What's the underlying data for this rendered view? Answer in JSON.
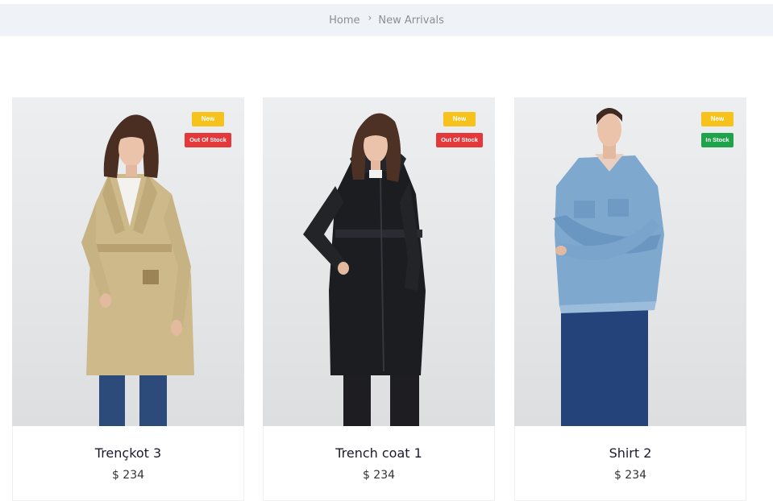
{
  "breadcrumb": {
    "home": "Home",
    "separator": ">",
    "current": "New Arrivals"
  },
  "products": [
    {
      "name": "Trençkot 3",
      "price": "$ 234",
      "badges": {
        "new": "New",
        "stock": "Out Of Stock"
      },
      "stock_status": "out"
    },
    {
      "name": "Trench coat 1",
      "price": "$ 234",
      "badges": {
        "new": "New",
        "stock": "Out Of Stock"
      },
      "stock_status": "out"
    },
    {
      "name": "Shirt 2",
      "price": "$ 234",
      "badges": {
        "new": "New",
        "stock": "In Stock"
      },
      "stock_status": "in"
    }
  ],
  "colors": {
    "breadcrumb_bg": "#eff3f7",
    "badge_new": "#f7c21b",
    "badge_out_of_stock": "#e5383b",
    "badge_in_stock": "#1ea34a"
  }
}
